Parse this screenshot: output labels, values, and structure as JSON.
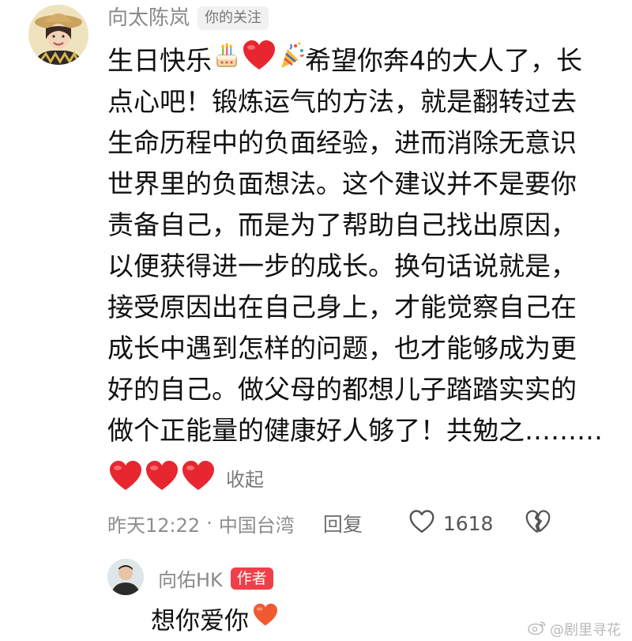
{
  "comment": {
    "author_name": "向太陈岚",
    "follow_badge": "你的关注",
    "lines": [
      {
        "before": "生日快乐",
        "after": "希望你奔4的大人了，长"
      },
      {
        "text": "点心吧！锻炼运气的方法，就是翻转过去"
      },
      {
        "text": "生命历程中的负面经验，进而消除无意识"
      },
      {
        "text": "世界里的负面想法。这个建议并不是要你"
      },
      {
        "text": "责备自己，而是为了帮助自己找出原因，"
      },
      {
        "text": "以便获得进一步的成长。换句话说就是，"
      },
      {
        "text": "接受原因出在自己身上，才能觉察自己在"
      },
      {
        "text": "成长中遇到怎样的问题，也才能够成为更"
      },
      {
        "text": "好的自己。做父母的都想儿子踏踏实实的"
      },
      {
        "text": "做个正能量的健康好人够了！共勉之………"
      }
    ],
    "collapse_label": "收起",
    "time": "昨天12:22",
    "separator": "·",
    "region": "中国台湾",
    "reply_label": "回复",
    "like_count": "1618"
  },
  "reply": {
    "author_name": "向佑HK",
    "author_badge": "作者",
    "text": "想你爱你"
  },
  "watermark": "@剧里寻花",
  "icons": {
    "cake": "cake-icon",
    "heart": "red-heart-icon",
    "party": "party-popper-icon",
    "like": "heart-outline-icon",
    "dislike": "broken-heart-icon",
    "watermark": "weibo-icon"
  },
  "colors": {
    "heart_red": "#e8262f",
    "author_badge_bg": "#ef3f4a",
    "meta_gray": "#8d8d8d"
  }
}
